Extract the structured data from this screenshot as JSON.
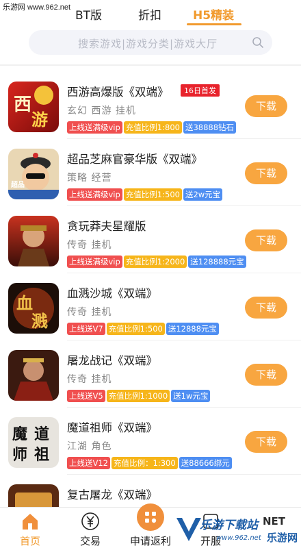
{
  "watermark_top": "乐游网 www.962.net",
  "tabs": [
    {
      "label": "BT版",
      "active": false
    },
    {
      "label": "折扣",
      "active": false
    },
    {
      "label": "H5精装",
      "active": true
    }
  ],
  "search": {
    "placeholder": "搜索游戏|游戏分类|游戏大厅"
  },
  "games": [
    {
      "title": "西游高爆版《双端》",
      "badge": "16日首发",
      "tags": "玄幻 西游 挂机",
      "pills": [
        "上线送满级vip",
        "充值比例1:800",
        "送38888钻石"
      ],
      "icon": "xiyou-game-icon",
      "download": "下载"
    },
    {
      "title": "超品芝麻官豪华版《双端》",
      "badge": "",
      "tags": "策略 经营",
      "pills": [
        "上线送满级vip",
        "充值比例1:500",
        "送2w元宝"
      ],
      "icon": "official-game-icon",
      "download": "下载"
    },
    {
      "title": "贪玩莽夫星耀版",
      "badge": "",
      "tags": "传奇 挂机",
      "pills": [
        "上线送满级vip",
        "充值比例1:2000",
        "送128888元宝"
      ],
      "icon": "warrior-game-icon",
      "download": "下载"
    },
    {
      "title": "血溅沙城《双端》",
      "badge": "",
      "tags": "传奇 挂机",
      "pills": [
        "上线送V7",
        "充值比例1:500",
        "送12888元宝"
      ],
      "icon": "xuejian-game-icon",
      "download": "下载"
    },
    {
      "title": "屠龙战记《双端》",
      "badge": "",
      "tags": "传奇 挂机",
      "pills": [
        "上线送V5",
        "充值比例1:1000",
        "送1w元宝"
      ],
      "icon": "tulong-game-icon",
      "download": "下载"
    },
    {
      "title": "魔道祖师《双端》",
      "badge": "",
      "tags": "江湖 角色",
      "pills": [
        "上线送V12",
        "充值比例：1:300",
        "送88666绑元"
      ],
      "icon": "modao-game-icon",
      "download": "下载"
    },
    {
      "title": "复古屠龙《双端》",
      "badge": "",
      "tags": "",
      "pills": [],
      "icon": "fugu-game-icon",
      "download": ""
    }
  ],
  "bottom_nav": [
    {
      "label": "首页",
      "icon": "home-icon",
      "active": true
    },
    {
      "label": "交易",
      "icon": "yuan-icon",
      "active": false
    },
    {
      "label": "申请返利",
      "icon": "apps-icon",
      "active": false
    },
    {
      "label": "开服",
      "icon": "server-icon",
      "active": false
    }
  ],
  "watermark_bottom": {
    "line1": "乐游下载站",
    "line2": "NET",
    "line3": "乐游网",
    "line4": "www.962.net"
  },
  "colors": {
    "accent": "#f19a2d",
    "download": "#f8a640",
    "pill_red": "#f04f4f",
    "pill_orange": "#f6b51a",
    "pill_blue": "#4e8ef2",
    "badge_new": "#e8232c"
  }
}
